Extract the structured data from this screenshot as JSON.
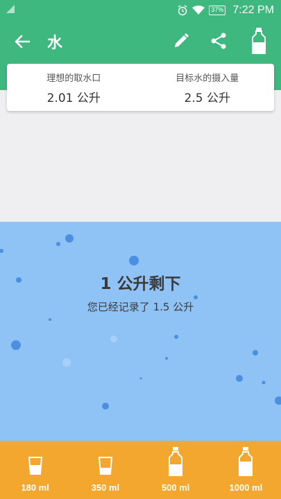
{
  "status_bar": {
    "battery": "37%",
    "time": "7:22 PM"
  },
  "toolbar": {
    "title": "水"
  },
  "summary": {
    "ideal_label": "理想的取水口",
    "ideal_value": "2.01 公升",
    "target_label": "目标水的摄入量",
    "target_value": "2.5 公升"
  },
  "progress": {
    "remaining": "1 公升剩下",
    "recorded": "您已经记录了 1.5 公升",
    "fraction_consumed": 0.6
  },
  "drinks": [
    {
      "label": "180 ml",
      "icon": "glass-small-icon"
    },
    {
      "label": "350 ml",
      "icon": "glass-large-icon"
    },
    {
      "label": "500 ml",
      "icon": "bottle-small-icon"
    },
    {
      "label": "1000 ml",
      "icon": "bottle-large-icon"
    }
  ],
  "colors": {
    "primary": "#3fb87f",
    "water": "#90c3f5",
    "bubble": "#4a8fe0",
    "accent": "#f4a72e"
  }
}
